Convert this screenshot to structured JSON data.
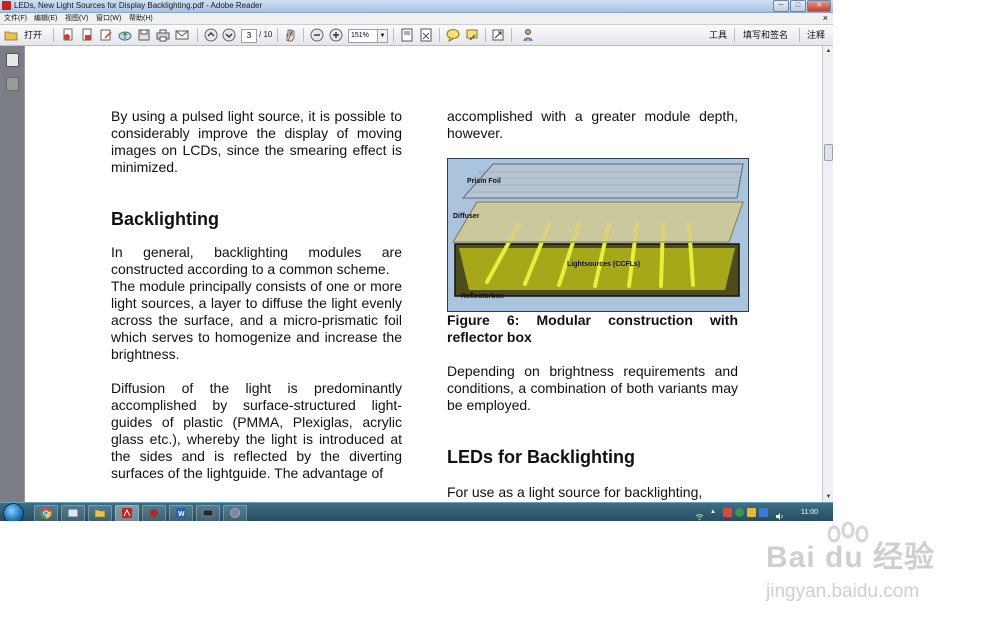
{
  "window": {
    "title": "LEDs, New Light Sources for Display Backlighting.pdf - Adobe Reader",
    "controls": [
      "─",
      "□",
      "✕"
    ]
  },
  "menubar": {
    "items": [
      "文件(F)",
      "编辑(E)",
      "视图(V)",
      "窗口(W)",
      "帮助(H)"
    ],
    "close_doc": "×"
  },
  "toolbar": {
    "open_label": "打开",
    "page_current": "3",
    "page_total": "/ 10",
    "zoom": "151%",
    "tools_label": "工具",
    "sign_label": "填写和签名",
    "comment_label": "注释"
  },
  "document": {
    "left_col": {
      "para1": "By using a pulsed light source, it is possible to considerably improve the display of moving images on LCDs, since the smearing effect is minimized.",
      "heading_backlighting": "Backlighting",
      "para2": "In general, backlighting modules are constructed according to a common scheme.",
      "para3": "The module principally consists of one or more light sources, a layer to diffuse the light evenly across the surface, and a micro-prismatic foil which serves to homogenize and increase the brightness.",
      "para4": "Diffusion of the light is predominantly accomplished by surface-structured light-guides of plastic (PMMA, Plexiglas, acrylic glass etc.), whereby the light is introduced at the sides and is reflected by the diverting surfaces of the lightguide. The advantage of"
    },
    "right_col": {
      "para1": "accomplished with a greater module depth, however.",
      "figure_labels": {
        "prism_foil": "Prism Foil",
        "diffuser": "Diffuser",
        "lightsources": "Lightsources (CCFLs)",
        "reflectorbox": "Reflectorbox"
      },
      "caption": "Figure 6: Modular construction with reflector box",
      "para2": "Depending on brightness requirements and conditions, a combination of both variants may be employed.",
      "heading_leds": "LEDs for Backlighting",
      "para3": "For use as a light source for backlighting,"
    }
  },
  "taskbar": {
    "clock": "11:00"
  },
  "watermark": {
    "brand": "Bai du 经验",
    "url": "jingyan.baidu.com"
  }
}
